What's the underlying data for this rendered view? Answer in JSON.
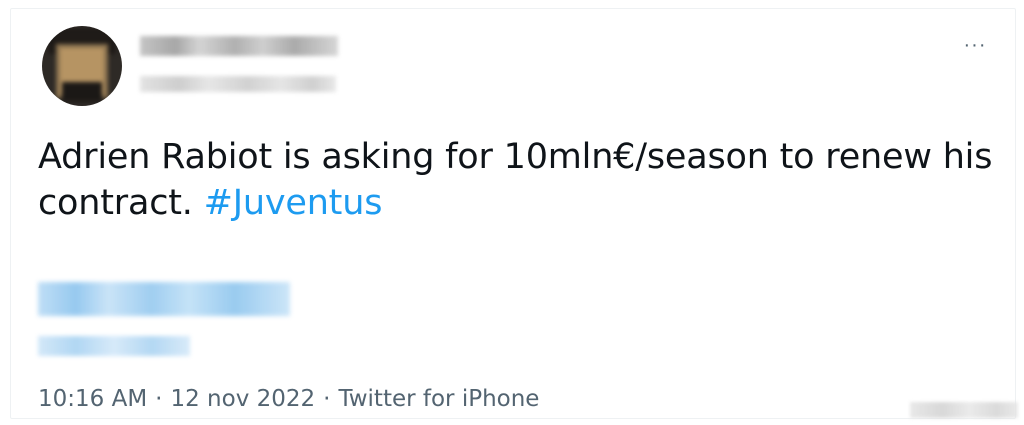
{
  "tweet": {
    "text_main": "Adrien Rabiot is asking for 10mln€/season to renew his contract. ",
    "hashtag": "#Juventus",
    "more_menu_label": "···",
    "timestamp": "10:16 AM",
    "separator": "·",
    "date": "12 nov 2022",
    "source": "Twitter for iPhone"
  }
}
